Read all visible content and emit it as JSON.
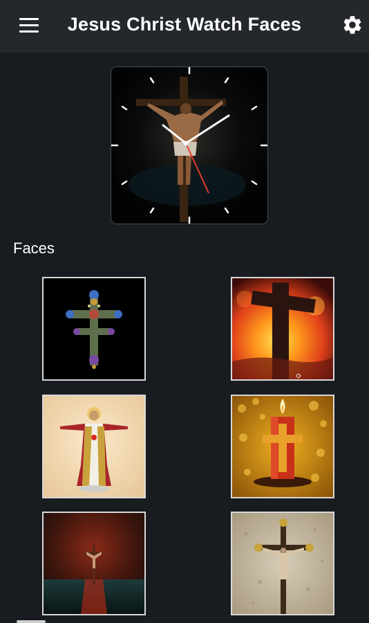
{
  "appbar": {
    "title": "Jesus Christ Watch Faces",
    "menu_icon": "hamburger-menu-icon",
    "settings_icon": "gear-icon"
  },
  "preview": {
    "image": "crucifix-on-dark-background",
    "hands_color": "#ffffff",
    "second_hand_color": "#e23b2e"
  },
  "faces_section": {
    "title": "Faces",
    "items": [
      {
        "image": "ornate-cross-black-background"
      },
      {
        "image": "cross-silhouette-sunset"
      },
      {
        "image": "sacred-heart-jesus-statue"
      },
      {
        "image": "candle-with-cross-gold-bokeh"
      },
      {
        "image": "crucifix-over-water-red-sky"
      },
      {
        "image": "crucifix-on-stone-wall"
      }
    ]
  }
}
